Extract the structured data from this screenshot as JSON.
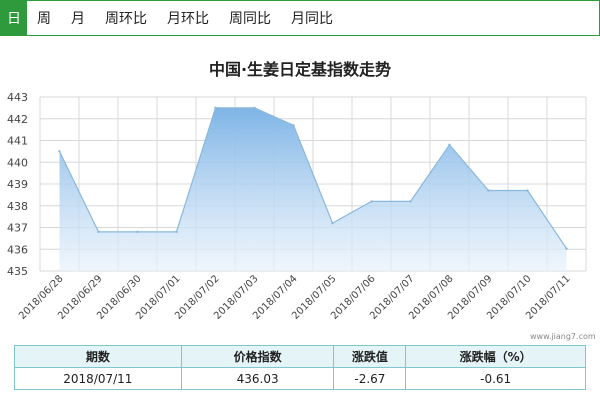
{
  "tabs": [
    "日",
    "周",
    "月",
    "周环比",
    "月环比",
    "周同比",
    "月同比"
  ],
  "active_tab": 0,
  "watermark": "www.jiang7.com",
  "table": {
    "headers": [
      "期数",
      "价格指数",
      "涨跌值",
      "涨跌幅（%）"
    ],
    "row": [
      "2018/07/11",
      "436.03",
      "-2.67",
      "-0.61"
    ]
  },
  "chart_data": {
    "type": "area",
    "title": "中国·生姜日定基指数走势",
    "categories": [
      "2018/06/28",
      "2018/06/29",
      "2018/06/30",
      "2018/07/01",
      "2018/07/02",
      "2018/07/03",
      "2018/07/04",
      "2018/07/05",
      "2018/07/06",
      "2018/07/07",
      "2018/07/08",
      "2018/07/09",
      "2018/07/10",
      "2018/07/11"
    ],
    "values": [
      440.5,
      436.8,
      436.8,
      436.8,
      442.5,
      442.5,
      441.7,
      437.2,
      438.2,
      438.2,
      440.8,
      438.7,
      438.7,
      436.03
    ],
    "ylim": [
      435,
      443
    ],
    "yticks": [
      435,
      436,
      437,
      438,
      439,
      440,
      441,
      442,
      443
    ],
    "grid": true,
    "colors": {
      "line": "#8ab8dc",
      "fill_top": "#7eb4e6",
      "fill_bottom": "#e8f2fb",
      "grid": "#d8d8d8",
      "axis_text": "#444"
    }
  }
}
